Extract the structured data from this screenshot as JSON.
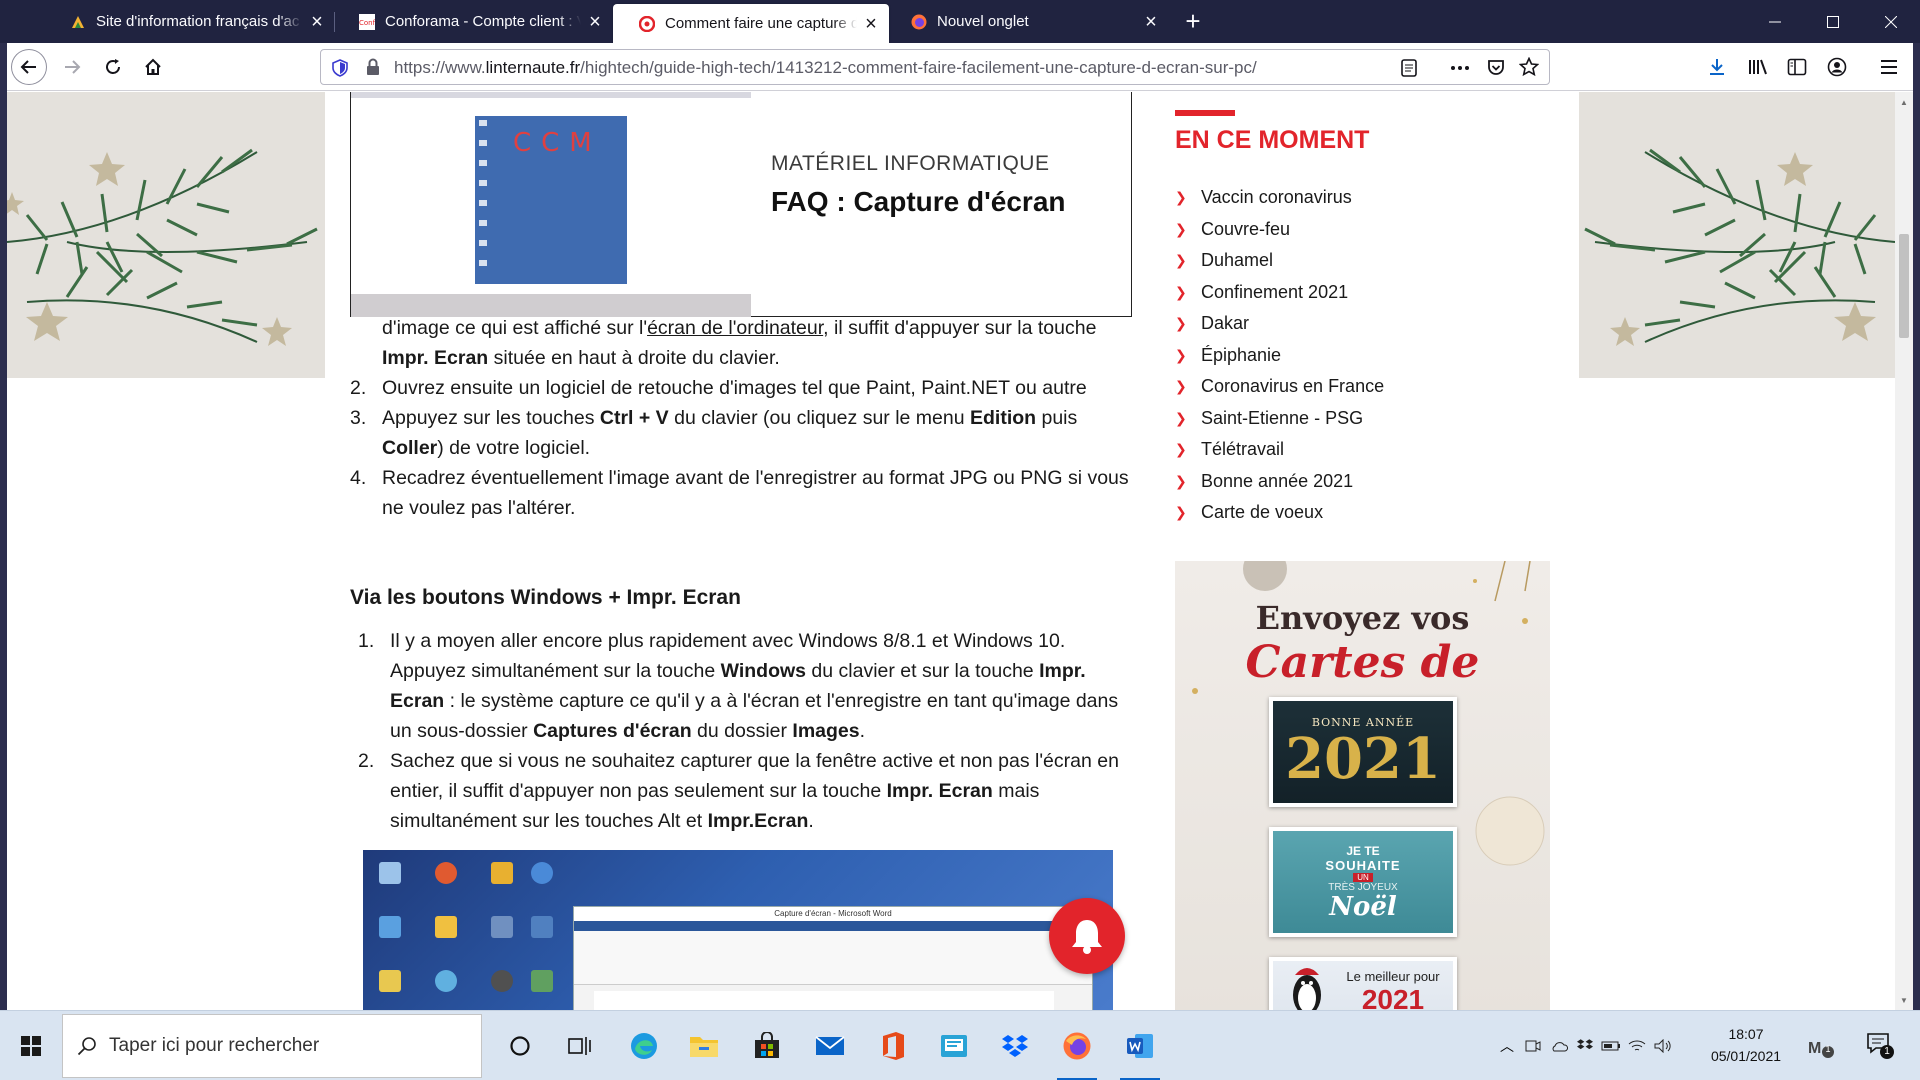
{
  "browser": {
    "tabs": [
      {
        "title": "Site d'information français d'ac",
        "active": false
      },
      {
        "title": "Conforama - Compte client : Vo",
        "active": false
      },
      {
        "title": "Comment faire une capture d'é",
        "active": true
      },
      {
        "title": "Nouvel onglet",
        "active": false
      }
    ],
    "url_prefix": "https://www.",
    "url_domain": "linternaute.fr",
    "url_path": "/hightech/guide-high-tech/1413212-comment-faire-facilement-une-capture-d-ecran-sur-pc/"
  },
  "article": {
    "faq_category": "MATÉRIEL INFORMATIQUE",
    "faq_title": "FAQ : Capture d'écran",
    "hero_caption": "CCM",
    "list1_tail": {
      "a": "d'image ce qui est affiché sur l'",
      "link": "écran de l'ordinateur",
      "b": ", il suffit d'appuyer sur la touche ",
      "bold1": "Impr. Ecran",
      "c": " située en haut à droite du clavier."
    },
    "list1": [
      {
        "num": "2.",
        "text": "Ouvrez ensuite un logiciel de retouche d'images tel que Paint, Paint.NET ou autre"
      },
      {
        "num": "3.",
        "a": "Appuyez sur les touches ",
        "b1": "Ctrl + V",
        "b": " du clavier (ou cliquez sur le menu ",
        "b2": "Edition",
        "c": " puis ",
        "b3": "Coller",
        "d": ") de votre logiciel."
      },
      {
        "num": "4.",
        "text": "Recadrez éventuellement l'image avant de l'enregistrer au format JPG ou PNG si vous ne voulez pas l'altérer."
      }
    ],
    "section_heading": "Via les boutons Windows + Impr. Ecran",
    "list2": [
      {
        "num": "1.",
        "a": "Il y a moyen aller encore plus rapidement avec Windows 8/8.1 et Windows 10. Appuyez simultanément sur la touche ",
        "b1": "Windows",
        "b": " du clavier et sur la touche ",
        "b2": "Impr. Ecran",
        "c": " : le système capture ce qu'il y a à l'écran et l'enregistre en tant qu'image dans un sous-dossier ",
        "b3": "Captures d'écran",
        "d": " du dossier ",
        "b4": "Images",
        "e": "."
      },
      {
        "num": "2.",
        "a": "Sachez que si vous ne souhaitez capturer que la fenêtre active et non pas l'écran en entier, il suffit d'appuyer non pas seulement sur la touche ",
        "b1": "Impr. Ecran",
        "b": " mais simultanément sur les touches Alt et ",
        "b2": "Impr.Ecran",
        "c": "."
      }
    ],
    "screenshot_window_title": "Capture d'écran - Microsoft Word"
  },
  "sidebar": {
    "title": "EN CE MOMENT",
    "items": [
      "Vaccin coronavirus",
      "Couvre-feu",
      "Duhamel",
      "Confinement 2021",
      "Dakar",
      "Épiphanie",
      "Coronavirus en France",
      "Saint-Etienne - PSG",
      "Télétravail",
      "Bonne année 2021",
      "Carte de voeux"
    ],
    "ad": {
      "line1": "Envoyez vos",
      "line2": "Cartes de voeux",
      "card1_top": "BONNE ANNÉE",
      "card1_big": "2021",
      "card2_a": "JE TE",
      "card2_b": "SOUHAITE",
      "card2_c": "UN",
      "card2_d": "TRÈS JOYEUX",
      "card2_e": "Noël",
      "card3_a": "Le meilleur pour",
      "card3_b": "2021"
    }
  },
  "taskbar": {
    "search_placeholder": "Taper ici pour rechercher",
    "time": "18:07",
    "date": "05/01/2021",
    "notification_count": "1"
  },
  "colors": {
    "accent_red": "#e2242b",
    "tabbar_bg": "#202340",
    "taskbar_bg": "#d9e4f1"
  }
}
